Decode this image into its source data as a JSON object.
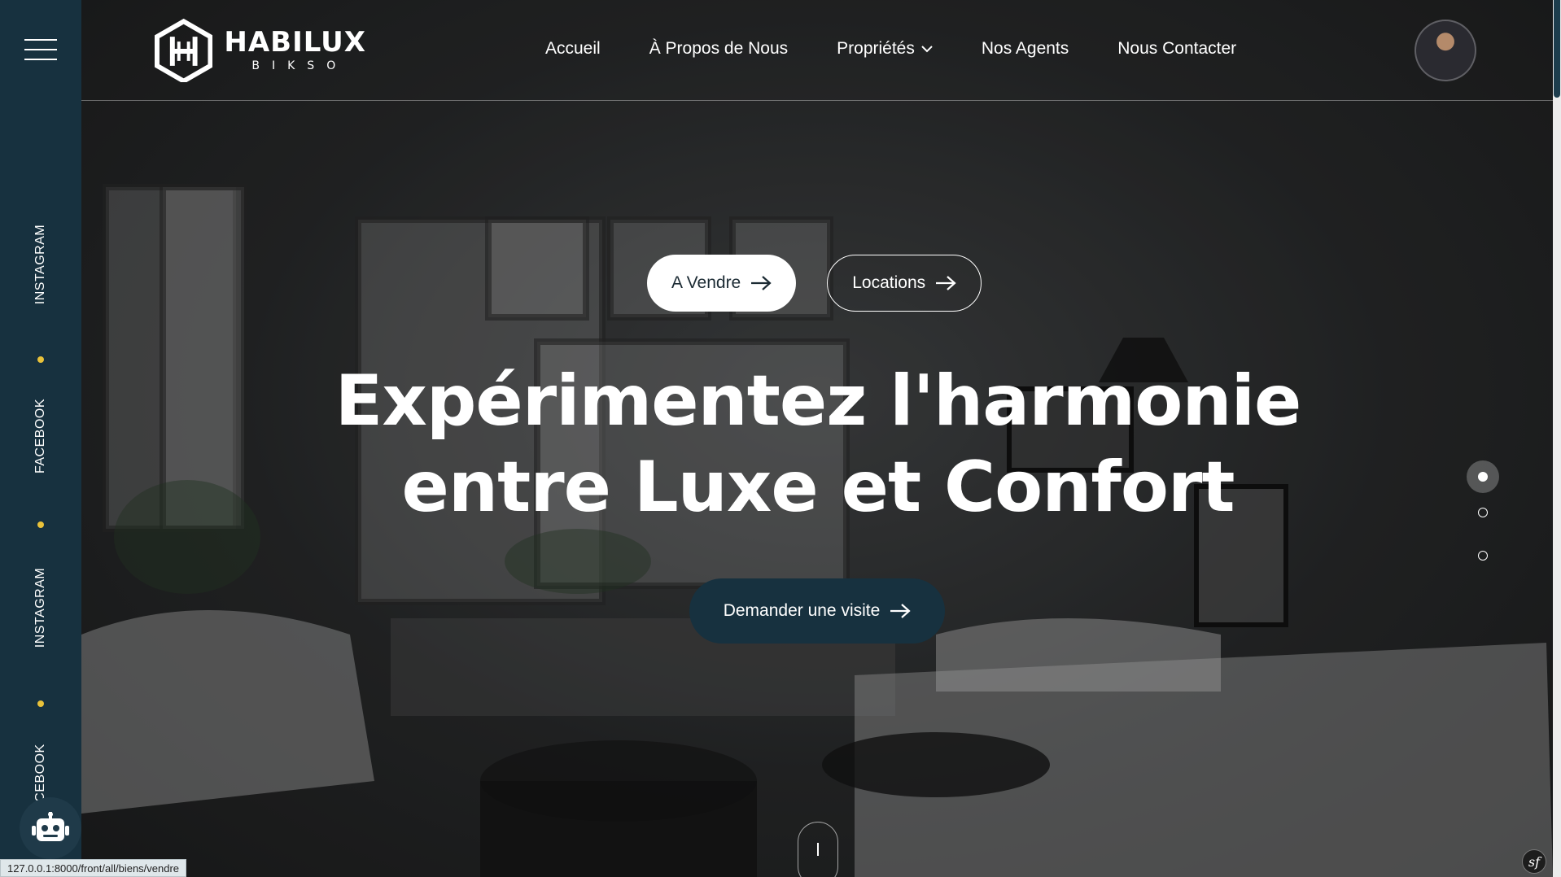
{
  "sidebar": {
    "social_links": [
      {
        "label": "INSTAGRAM"
      },
      {
        "label": "FACEBOOK"
      },
      {
        "label": "INSTAGRAM"
      },
      {
        "label": "CEBOOK"
      }
    ],
    "accent_color": "#e9c23a"
  },
  "header": {
    "logo": {
      "name": "HABILUX",
      "sub": "BIKSO"
    },
    "nav": [
      {
        "label": "Accueil"
      },
      {
        "label": "À Propos de Nous"
      },
      {
        "label": "Propriétés",
        "has_dropdown": true
      },
      {
        "label": "Nos Agents"
      },
      {
        "label": "Nous Contacter"
      }
    ]
  },
  "hero": {
    "filters": [
      {
        "label": "A Vendre",
        "active": true
      },
      {
        "label": "Locations",
        "active": false
      }
    ],
    "headline_line1": "Expérimentez l'harmonie",
    "headline_line2": "entre Luxe et Confort",
    "cta_label": "Demander une visite",
    "slides": {
      "count": 3,
      "active_index": 0
    }
  },
  "status_bar": {
    "url": "127.0.0.1:8000/front/all/biens/vendre"
  },
  "colors": {
    "primary_dark": "#17313f",
    "accent": "#e9c23a",
    "white": "#ffffff"
  }
}
